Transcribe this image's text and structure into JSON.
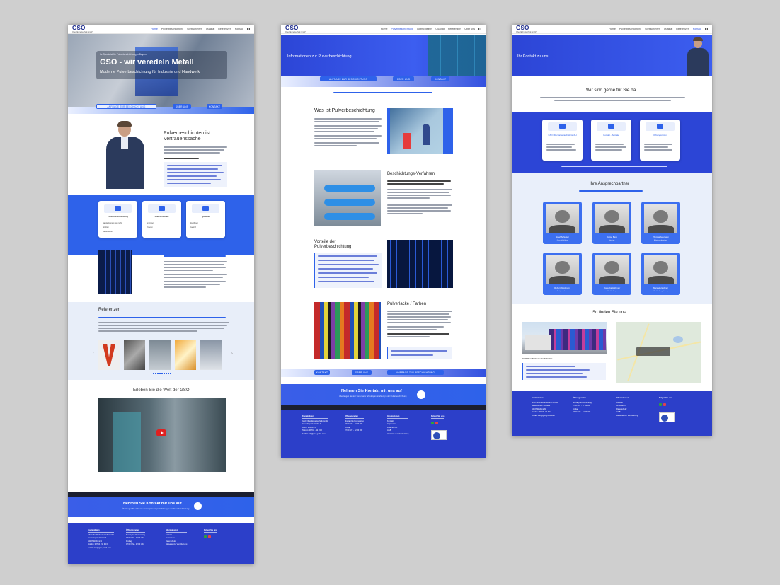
{
  "brand": {
    "logo": "GSO",
    "tagline": "Oberflächentechnik GmbH",
    "accent": "#2e62ea",
    "dark_blue": "#2c3fc9"
  },
  "nav": {
    "items": [
      "Home",
      "Pulverbeschichtung",
      "Gleitschleifen",
      "Qualität",
      "Referenzen",
      "Über uns",
      "Kontakt"
    ],
    "search_icon": "search-icon"
  },
  "nav_short": {
    "items": [
      "Home",
      "Pulverbeschichtung",
      "Gleitschleifen",
      "Qualität",
      "Referenzen",
      "Über uns",
      "Kontakt"
    ]
  },
  "home": {
    "hero_kicker": "Ihr Spezialist für Pulverbeschichtung in Bayern",
    "hero_title": "GSO - wir veredeln Metall",
    "hero_sub": "Moderne Pulverbeschichtung für Industrie und Handwerk",
    "buttons": [
      "ANFRAGE ZUR BESCHICHTUNG",
      "ÜBER UNS",
      "KONTAKT"
    ],
    "intro_title_1": "Pulverbeschichten ist",
    "intro_title_2": "Vertrauenssache",
    "services": [
      {
        "title": "Pulverbeschichtung",
        "lines": [
          "Nasslackierung und mehr",
          "Strahlen",
          "Gleitschleifen"
        ]
      },
      {
        "title": "Gleitschleifen",
        "lines": [
          "Entgraten",
          "Polieren"
        ]
      },
      {
        "title": "Qualität",
        "lines": [
          "Zertifiziert",
          "Geprüft"
        ]
      }
    ],
    "references_title": "Referenzen",
    "video_title": "Erleben Sie die Welt der GSO",
    "cta": "Nehmen Sie Kontakt mit uns auf",
    "cta_sub": "Überzeugen Sie sich von unserer jahrelangen Erfahrung in der Pulverbeschichtung"
  },
  "powder": {
    "banner_title": "Informationen zur Pulverbeschichtung",
    "buttons": [
      "ANFRAGE ZUR BESCHICHTUNG",
      "ÜBER UNS",
      "KONTAKT"
    ],
    "sections": [
      {
        "title": "Was ist Pulverbeschichtung"
      },
      {
        "title": "Beschichtungs-Verfahren"
      },
      {
        "title": "Vorteile der Pulverbeschichtung"
      },
      {
        "title": "Pulverlacke / Farben"
      }
    ],
    "bottom_buttons": [
      "KONTAKT",
      "ÜBER UNS",
      "ANFRAGE ZUR BESCHICHTUNG"
    ],
    "cta": "Nehmen Sie Kontakt mit uns auf",
    "cta_sub": "Überzeugen Sie sich von unserer jahrelangen Erfahrung in der Pulverbeschichtung"
  },
  "contact": {
    "banner_title": "Ihr Kontakt zu uns",
    "section_title": "Wir sind gerne für Sie da",
    "cards": [
      {
        "title": "GSO Oberflächentechnik GmbH"
      },
      {
        "title": "Kontakt - Zentrale"
      },
      {
        "title": "Öffnungszeiten"
      }
    ],
    "partners_title": "Ihre Ansprechpartner",
    "partners": [
      {
        "name": "Josef Schuster",
        "role": "Geschäftsführer"
      },
      {
        "name": "Daniel Berg",
        "role": "Vertrieb"
      },
      {
        "name": "Thomas Auerhahn",
        "role": "Arbeitsvorbereitung"
      },
      {
        "name": "Robert Weidmann",
        "role": "Fertigungsleiter"
      },
      {
        "name": "Roswitha Hollinger",
        "role": "Buchhaltung"
      },
      {
        "name": "Manuela Eichner",
        "role": "Buchhaltungsleitung"
      }
    ],
    "find_title": "So finden Sie uns"
  },
  "footer": {
    "columns": [
      {
        "head": "Kontaktdaten",
        "lines": [
          "GSO Oberflächentechnik GmbH",
          "Gewerbepark Straße 2",
          "84107 Weihmichl",
          "Telefon: 08704 - 92 93 0",
          "E-Mail: info@gso-gmbh.com"
        ]
      },
      {
        "head": "Öffnungszeiten",
        "lines": [
          "Montag bis Donnerstag",
          "07:00 Uhr - 17:00 Uhr",
          "Freitag",
          "07:00 Uhr - 12:00 Uhr"
        ]
      },
      {
        "head": "Informationen",
        "lines": [
          "Kontakt",
          "Impressum",
          "Datenschutz",
          "AGB",
          "Hinweise zur Verarbeitung"
        ]
      },
      {
        "head": "Folgen Sie uns",
        "lines": []
      }
    ]
  }
}
